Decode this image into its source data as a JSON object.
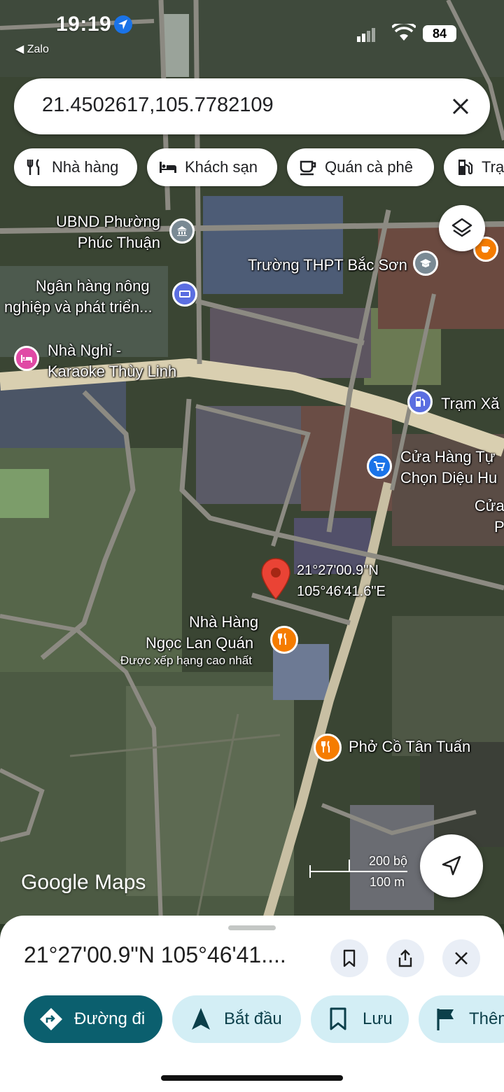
{
  "status_bar": {
    "time": "19:19",
    "back_app": "◀ Zalo",
    "battery": "84"
  },
  "search": {
    "query": "21.4502617,105.7782109"
  },
  "chips": [
    {
      "label": "Nhà hàng",
      "icon": "restaurant-icon"
    },
    {
      "label": "Khách sạn",
      "icon": "hotel-icon"
    },
    {
      "label": "Quán cà phê",
      "icon": "coffee-icon"
    },
    {
      "label": "Trạ",
      "icon": "gas-station-icon"
    }
  ],
  "map": {
    "pois": {
      "ubnd_line1": "UBND Phường",
      "ubnd_line2": "Phúc Thuận",
      "school": "Trường THPT Bắc Sơn",
      "bank_line1": "Ngân hàng nông",
      "bank_line2": "nghiệp và phát triển...",
      "guesthouse_line1": "Nhà Nghỉ -",
      "guesthouse_line2": "Karaoke Thùy Linh",
      "gas": "Trạm Xă",
      "store_line1": "Cửa Hàng Tự",
      "store_line2": "Chọn Diệu Hu",
      "store2_line1": "Cửa",
      "store2_line2": "P",
      "restaurant_line1": "Nhà Hàng",
      "restaurant_line2": "Ngọc Lan Quán",
      "restaurant_rating": "Được xếp hạng cao nhất",
      "pho": "Phở Cồ Tân Tuấn"
    },
    "pin_lat": "21°27'00.9\"N",
    "pin_lng": "105°46'41.6\"E",
    "logo": "Google Maps",
    "scale_top": "200 bộ",
    "scale_bottom": "100 m",
    "colors": {
      "road": "#d9cfb0",
      "pin_red": "#ea4335",
      "poi_blue": "#5b6ee1",
      "poi_pink": "#e04aa5",
      "poi_orange": "#f57c00",
      "poi_gray": "#7a8a94"
    }
  },
  "sheet": {
    "title": "21°27'00.9\"N 105°46'41....",
    "actions": [
      {
        "label": "Đường đi",
        "icon": "directions-icon"
      },
      {
        "label": "Bắt đầu",
        "icon": "navigation-icon"
      },
      {
        "label": "Lưu",
        "icon": "bookmark-icon"
      },
      {
        "label": "Thêm",
        "icon": "flag-icon"
      }
    ],
    "colors": {
      "primary": "#0b5f6e",
      "tonal": "#d3eef5"
    }
  }
}
